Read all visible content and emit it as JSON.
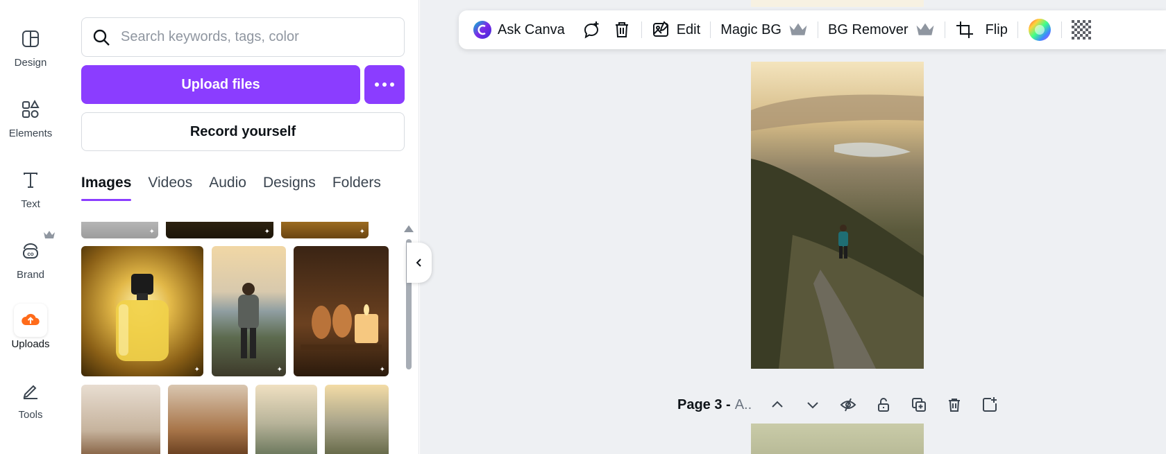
{
  "rail": {
    "items": [
      {
        "label": "Design",
        "icon": "design-icon"
      },
      {
        "label": "Elements",
        "icon": "elements-icon"
      },
      {
        "label": "Text",
        "icon": "text-icon"
      },
      {
        "label": "Brand",
        "icon": "brand-icon",
        "premium": true
      },
      {
        "label": "Uploads",
        "icon": "uploads-icon",
        "active": true
      },
      {
        "label": "Tools",
        "icon": "tools-icon"
      }
    ]
  },
  "panel": {
    "search_placeholder": "Search keywords, tags, color",
    "upload_label": "Upload files",
    "record_label": "Record yourself",
    "tabs": [
      {
        "label": "Images",
        "active": true
      },
      {
        "label": "Videos"
      },
      {
        "label": "Audio"
      },
      {
        "label": "Designs"
      },
      {
        "label": "Folders"
      }
    ]
  },
  "toolbar": {
    "ask_canva": "Ask Canva",
    "edit": "Edit",
    "magic_bg": "Magic BG",
    "bg_remover": "BG Remover",
    "flip": "Flip"
  },
  "page": {
    "title": "Page 3 -",
    "subtitle": "A.."
  },
  "colors": {
    "accent": "#8b3dff",
    "uploads_icon": "#ff6b1a",
    "canvas_bg": "#eef0f3"
  }
}
